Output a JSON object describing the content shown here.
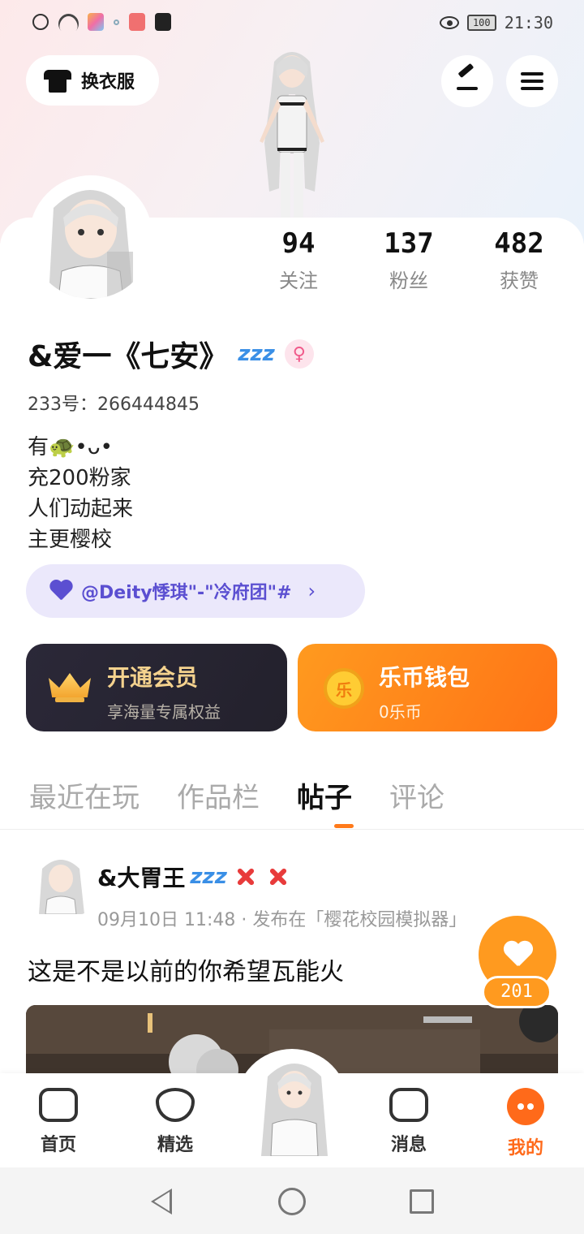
{
  "status_bar": {
    "battery": "100",
    "time": "21:30"
  },
  "header": {
    "outfit_label": "换衣服"
  },
  "stats": [
    {
      "num": "94",
      "label": "关注"
    },
    {
      "num": "137",
      "label": "粉丝"
    },
    {
      "num": "482",
      "label": "获赞"
    }
  ],
  "profile": {
    "nickname": "&爱一《七安》",
    "zzz": "zzz",
    "gender": "♀",
    "uid": "233号：266444845",
    "bio": [
      "有🐢•ᴗ•",
      "充200粉家",
      "人们动起来",
      "主更樱校"
    ]
  },
  "group": {
    "text": "@Deity悸琪\"-\"冷府团\"#",
    "chevron": "›"
  },
  "vip": {
    "title": "开通会员",
    "subtitle": "享海量专属权益"
  },
  "wallet": {
    "title": "乐币钱包",
    "subtitle": "0乐币",
    "coin": "乐"
  },
  "tabs": [
    "最近在玩",
    "作品栏",
    "帖子",
    "评论"
  ],
  "post": {
    "author": "&大胃王",
    "zzz": "zzz",
    "meta": "09月10日 11:48 · 发布在「樱花校园模拟器」",
    "text": "这是不是以前的你希望瓦能火",
    "likes": "201"
  },
  "bottom_nav": [
    "首页",
    "精选",
    "消息",
    "我的"
  ],
  "colors": {
    "accent": "#ff7a1a",
    "group_purple": "#5b4fd1",
    "vip_gold": "#f4d28e"
  }
}
